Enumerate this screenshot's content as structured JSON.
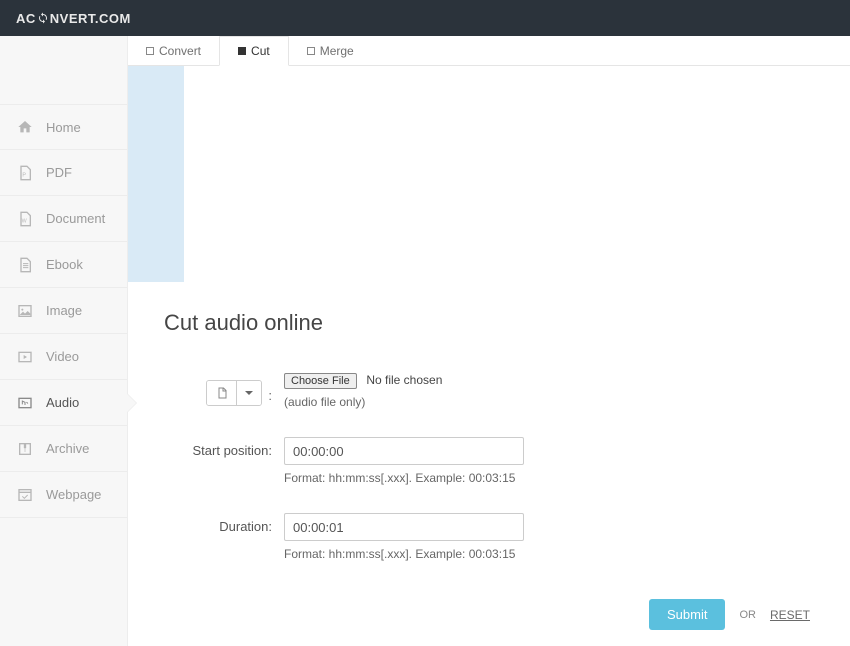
{
  "brand": {
    "pre": "AC",
    "post": "NVERT.COM"
  },
  "sidebar": {
    "items": [
      {
        "label": "Home"
      },
      {
        "label": "PDF"
      },
      {
        "label": "Document"
      },
      {
        "label": "Ebook"
      },
      {
        "label": "Image"
      },
      {
        "label": "Video"
      },
      {
        "label": "Audio"
      },
      {
        "label": "Archive"
      },
      {
        "label": "Webpage"
      }
    ]
  },
  "tabs": {
    "items": [
      {
        "label": "Convert"
      },
      {
        "label": "Cut"
      },
      {
        "label": "Merge"
      }
    ]
  },
  "page": {
    "title": "Cut audio online"
  },
  "file": {
    "choose_label": "Choose File",
    "status": "No file chosen",
    "hint": "(audio file only)"
  },
  "start": {
    "label": "Start position:",
    "value": "00:00:00",
    "hint": "Format: hh:mm:ss[.xxx]. Example: 00:03:15"
  },
  "duration": {
    "label": "Duration:",
    "value": "00:00:01",
    "hint": "Format: hh:mm:ss[.xxx]. Example: 00:03:15"
  },
  "actions": {
    "submit": "Submit",
    "or": "OR",
    "reset": "RESET"
  }
}
